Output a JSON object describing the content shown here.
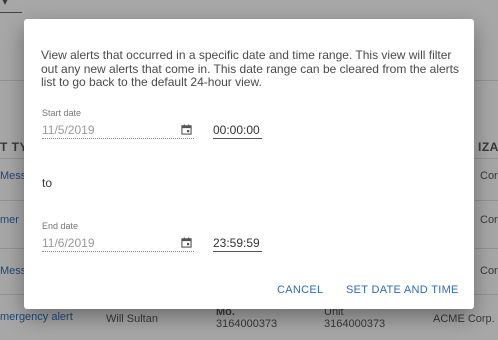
{
  "background": {
    "column_header_left": "T TYP",
    "column_header_right": "IZAT",
    "rows": [
      {
        "link": "Mess",
        "org": "Corp."
      },
      {
        "link": "mer",
        "org": "Corp."
      },
      {
        "link": "Mess",
        "org": "Corp."
      }
    ],
    "last_row": {
      "alert": "mergency alert",
      "user": "Will Sultan",
      "mobile_label": "Mo.",
      "mobile_number": "3164000373",
      "unit_label": "Unit",
      "unit_number": "3164000373",
      "org": "ACME Corp."
    }
  },
  "dialog": {
    "description": "View alerts that occurred in a specific date and time range. This view will filter out any new alerts that come in. This date range can be cleared from the alerts list to go back to the default 24-hour view.",
    "start": {
      "label": "Start date",
      "date": "11/5/2019",
      "time": "00:00:00"
    },
    "to_label": "to",
    "end": {
      "label": "End date",
      "date": "11/6/2019",
      "time": "23:59:59"
    },
    "actions": {
      "cancel": "CANCEL",
      "confirm": "SET DATE AND TIME"
    },
    "icons": {
      "start_date": "calendar-icon",
      "end_date": "calendar-icon"
    }
  }
}
